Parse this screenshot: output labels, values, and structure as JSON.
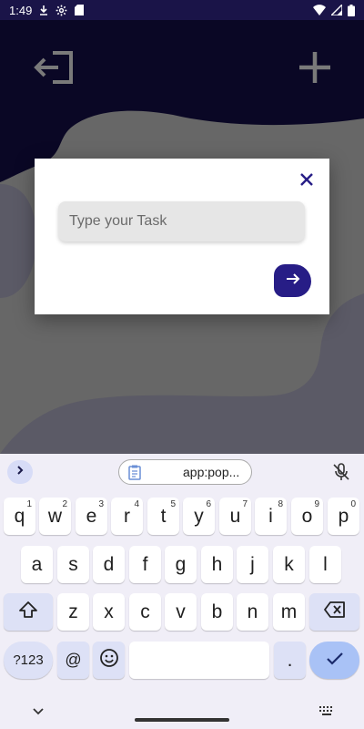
{
  "status_bar": {
    "time": "1:49",
    "icons": [
      "download-icon",
      "settings-icon",
      "sd-card-icon",
      "wifi-icon",
      "signal-icon",
      "battery-icon"
    ]
  },
  "app": {
    "header_icons": [
      "logout-icon",
      "add-icon"
    ],
    "colors": {
      "header": "#140f4a",
      "accent": "#271d86",
      "blob": "#b7b5cc"
    }
  },
  "dialog": {
    "input_placeholder": "Type your Task",
    "input_value": "",
    "close_icon": "close-icon",
    "submit_icon": "arrow-right-icon"
  },
  "keyboard": {
    "clipboard_suggestion": "app:pop...",
    "rows": [
      {
        "keys": [
          "q",
          "w",
          "e",
          "r",
          "t",
          "y",
          "u",
          "i",
          "o",
          "p"
        ],
        "hints": [
          "1",
          "2",
          "3",
          "4",
          "5",
          "6",
          "7",
          "8",
          "9",
          "0"
        ]
      },
      {
        "keys": [
          "a",
          "s",
          "d",
          "f",
          "g",
          "h",
          "j",
          "k",
          "l"
        ]
      },
      {
        "keys": [
          "z",
          "x",
          "c",
          "v",
          "b",
          "n",
          "m"
        ]
      }
    ],
    "symbols_label": "?123",
    "at_label": "@",
    "period_label": ".",
    "comma_label": ","
  }
}
